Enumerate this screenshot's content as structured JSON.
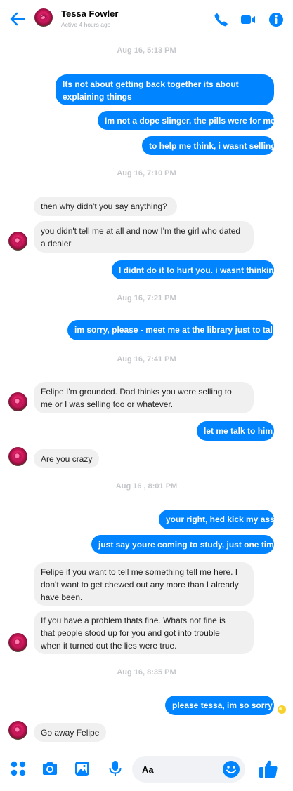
{
  "header": {
    "contact_name": "Tessa Fowler",
    "status": "Active 4 hours ago",
    "icons": [
      "back-arrow-icon",
      "phone-icon",
      "video-camera-icon",
      "info-icon"
    ]
  },
  "conversation": {
    "timestamps": [
      "Aug 16, 5:13 PM",
      "Aug 16, 7:10 PM",
      "Aug 16, 7:21 PM",
      "Aug 16, 7:41 PM",
      "Aug 16 , 8:01 PM",
      "Aug 16, 8:35 PM"
    ],
    "messages": [
      {
        "from": "me",
        "lines": [
          "Its not about getting back together its about",
          "explaining things"
        ]
      },
      {
        "from": "me",
        "lines": [
          "Im not a dope slinger, the pills were for me"
        ]
      },
      {
        "from": "me",
        "lines": [
          "to help me think, i wasnt selling"
        ]
      },
      {
        "from": "them",
        "lines": [
          "then why didn't you say anything?"
        ]
      },
      {
        "from": "them",
        "lines": [
          "you didn't tell me at all and now I'm the girl who dated",
          "a dealer"
        ]
      },
      {
        "from": "me",
        "lines": [
          "I didnt do it to hurt you. i wasnt thinking"
        ]
      },
      {
        "from": "me",
        "lines": [
          "im sorry, please - meet me at the library just to talk"
        ]
      },
      {
        "from": "them",
        "lines": [
          "Felipe I'm grounded. Dad thinks you were selling to",
          "me or I was selling too or whatever."
        ]
      },
      {
        "from": "me",
        "lines": [
          "let me talk to him"
        ]
      },
      {
        "from": "them",
        "lines": [
          "Are you crazy"
        ]
      },
      {
        "from": "me",
        "lines": [
          "your right, hed kick my ass"
        ]
      },
      {
        "from": "me",
        "lines": [
          "just say youre coming to study, just one time"
        ]
      },
      {
        "from": "them",
        "lines": [
          "Felipe if you want to tell me something tell me here. I",
          "don't want to get chewed out any more than I already",
          "have been."
        ]
      },
      {
        "from": "them",
        "lines": [
          "If you have a problem thats fine. Whats not fine is",
          "that people stood up for you and got into trouble",
          "when it turned out the lies were true."
        ]
      },
      {
        "from": "me",
        "lines": [
          "please tessa, im so sorry"
        ]
      },
      {
        "from": "them",
        "lines": [
          "Go away Felipe"
        ]
      }
    ]
  },
  "composer": {
    "placeholder": "Aa",
    "icons": [
      "menu-dots-icon",
      "camera-icon",
      "gallery-icon",
      "microphone-icon",
      "emoji-icon",
      "thumbs-up-icon"
    ]
  },
  "colors": {
    "accent": "#0084ff",
    "incoming_bubble": "#f0f0f0",
    "timestamp": "#c4c6ca"
  }
}
